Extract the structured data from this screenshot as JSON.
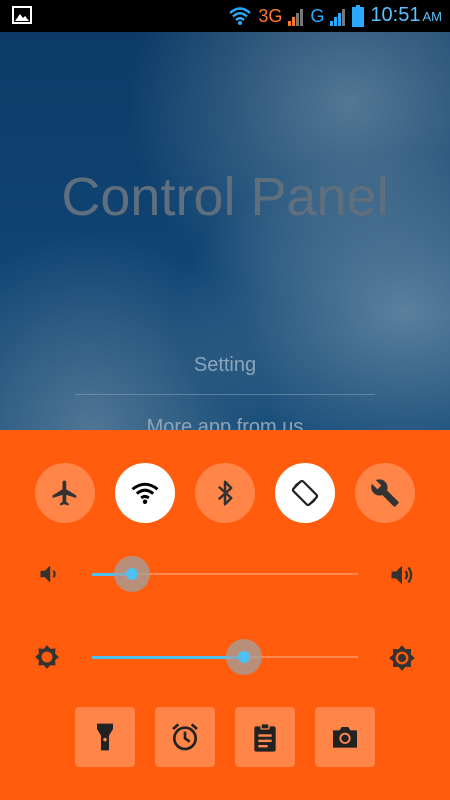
{
  "status_bar": {
    "left_icon": "gallery-image-icon",
    "network_1": "3G",
    "network_2": "G",
    "time": "10:51",
    "ampm": "AM"
  },
  "app": {
    "title": "Control Panel",
    "menu": [
      "Setting",
      "More app from us"
    ]
  },
  "panel": {
    "color": "#ff5d0d",
    "toggles": [
      {
        "icon": "airplane-icon",
        "on": false
      },
      {
        "icon": "wifi-icon",
        "on": true
      },
      {
        "icon": "bluetooth-icon",
        "on": false
      },
      {
        "icon": "auto-rotate-icon",
        "on": true
      },
      {
        "icon": "wrench-icon",
        "on": false
      }
    ],
    "volume": {
      "level": 0.15,
      "accent": "#4ec1f3"
    },
    "brightness": {
      "level": 0.57,
      "accent": "#4ec1f3"
    },
    "tools": [
      "flashlight-icon",
      "alarm-clock-icon",
      "clipboard-icon",
      "camera-icon"
    ]
  }
}
